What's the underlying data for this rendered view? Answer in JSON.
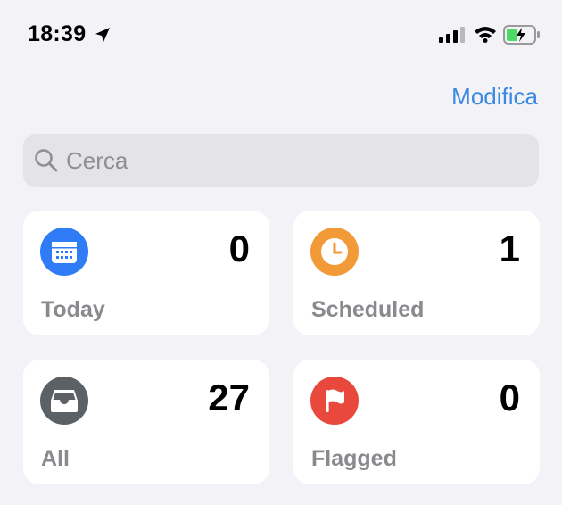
{
  "status_bar": {
    "time": "18:39",
    "location_icon": "location-arrow-icon",
    "signal_icon": "cellular-signal-icon",
    "wifi_icon": "wifi-icon",
    "battery_icon": "battery-charging-icon",
    "battery_color": "#4cd964"
  },
  "header": {
    "edit_label": "Modifica"
  },
  "search": {
    "placeholder": "Cerca",
    "icon": "search-icon"
  },
  "lists": [
    {
      "label": "Today",
      "count": "0",
      "icon": "calendar-icon",
      "color": "#2f7cf6"
    },
    {
      "label": "Scheduled",
      "count": "1",
      "icon": "clock-icon",
      "color": "#f19a37"
    },
    {
      "label": "All",
      "count": "27",
      "icon": "tray-icon",
      "color": "#5c6166"
    },
    {
      "label": "Flagged",
      "count": "0",
      "icon": "flag-icon",
      "color": "#e8493c"
    }
  ],
  "colors": {
    "background": "#f2f2f7",
    "accent": "#3b8ae0",
    "card": "#ffffff"
  }
}
